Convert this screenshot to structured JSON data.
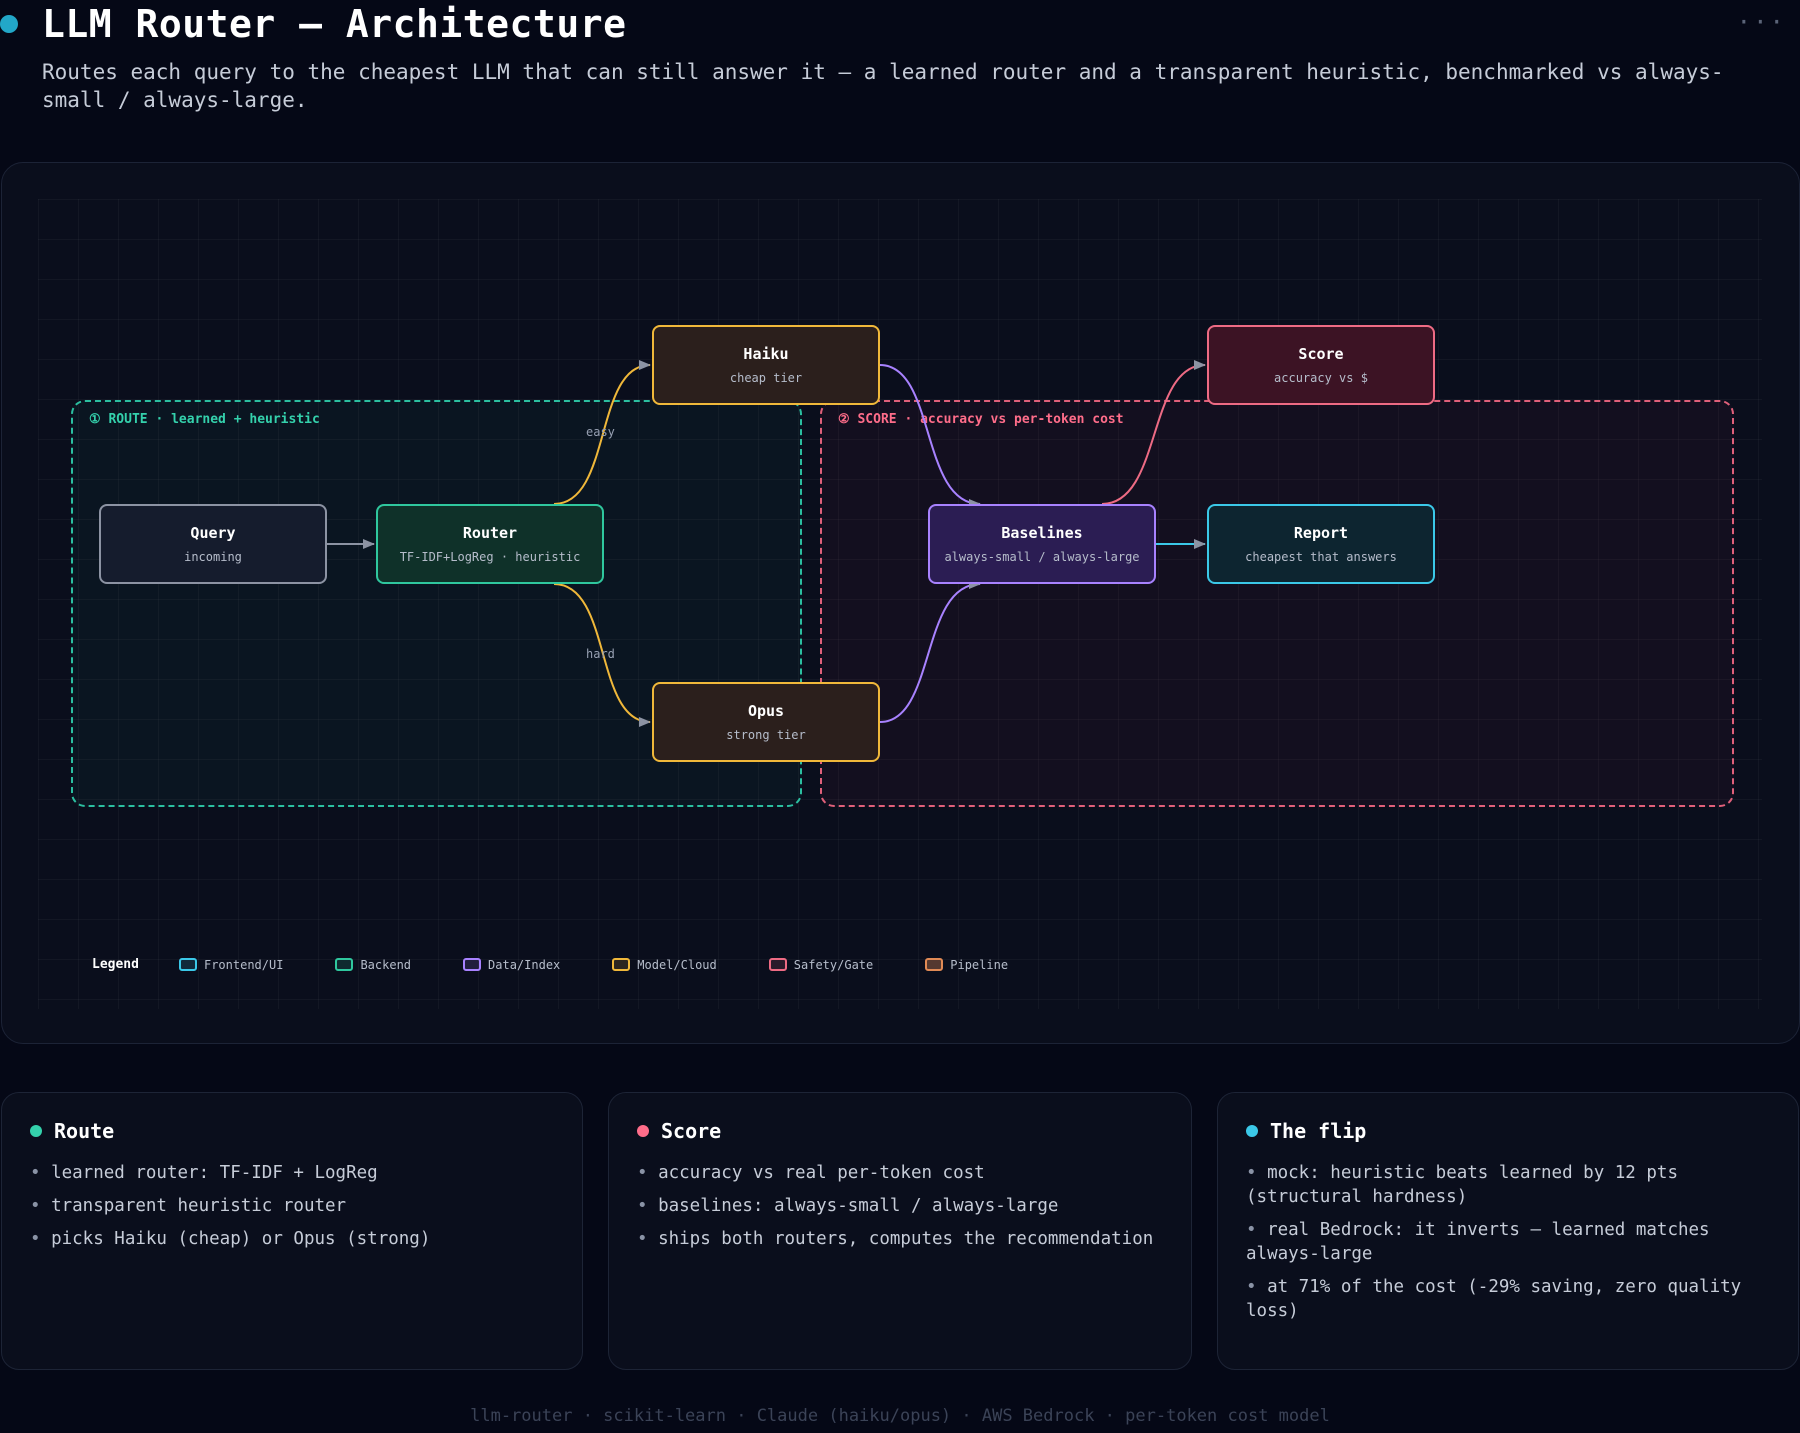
{
  "header": {
    "title": "LLM Router — Architecture",
    "subtitle": "Routes each query to the cheapest LLM that can still answer it — a learned router and a transparent heuristic, benchmarked vs always-small / always-large.",
    "more": "···"
  },
  "diagram": {
    "groups": {
      "route": "① ROUTE · learned + heuristic",
      "score": "② SCORE · accuracy vs per-token cost"
    },
    "nodes": {
      "query": {
        "title": "Query",
        "sub": "incoming"
      },
      "router": {
        "title": "Router",
        "sub": "TF-IDF+LogReg · heuristic"
      },
      "haiku": {
        "title": "Haiku",
        "sub": "cheap tier"
      },
      "opus": {
        "title": "Opus",
        "sub": "strong tier"
      },
      "baselines": {
        "title": "Baselines",
        "sub": "always-small / always-large"
      },
      "score": {
        "title": "Score",
        "sub": "accuracy vs $"
      },
      "report": {
        "title": "Report",
        "sub": "cheapest that answers"
      }
    },
    "edge_labels": {
      "easy": "easy",
      "hard": "hard"
    },
    "colors": {
      "route": "#2bbfa0",
      "score": "#e0607a",
      "model": "#f0b83a",
      "data": "#a882ff",
      "frontend": "#3bc8e8",
      "neutral": "#8c93a3"
    }
  },
  "legend": {
    "title": "Legend",
    "items": [
      {
        "label": "Frontend/UI",
        "color": "#3bc8e8"
      },
      {
        "label": "Backend",
        "color": "#2fc79e"
      },
      {
        "label": "Data/Index",
        "color": "#a882ff"
      },
      {
        "label": "Model/Cloud",
        "color": "#f0b83a"
      },
      {
        "label": "Safety/Gate",
        "color": "#ee6b84"
      },
      {
        "label": "Pipeline",
        "color": "#e08a55"
      }
    ]
  },
  "cards": [
    {
      "title": "Route",
      "dot": "#34d1ac",
      "items": [
        "learned router: TF-IDF + LogReg",
        "transparent heuristic router",
        "picks Haiku (cheap) or Opus (strong)"
      ]
    },
    {
      "title": "Score",
      "dot": "#ff6d8a",
      "items": [
        "accuracy vs real per-token cost",
        "baselines: always-small / always-large",
        "ships both routers, computes the recommendation"
      ]
    },
    {
      "title": "The flip",
      "dot": "#3bc8e8",
      "items": [
        "mock: heuristic beats learned by 12 pts (structural hardness)",
        "real Bedrock: it inverts — learned matches always-large",
        "at 71% of the cost (-29% saving, zero quality loss)"
      ]
    }
  ],
  "footer": "llm-router · scikit-learn · Claude (haiku/opus) · AWS Bedrock · per-token cost model"
}
